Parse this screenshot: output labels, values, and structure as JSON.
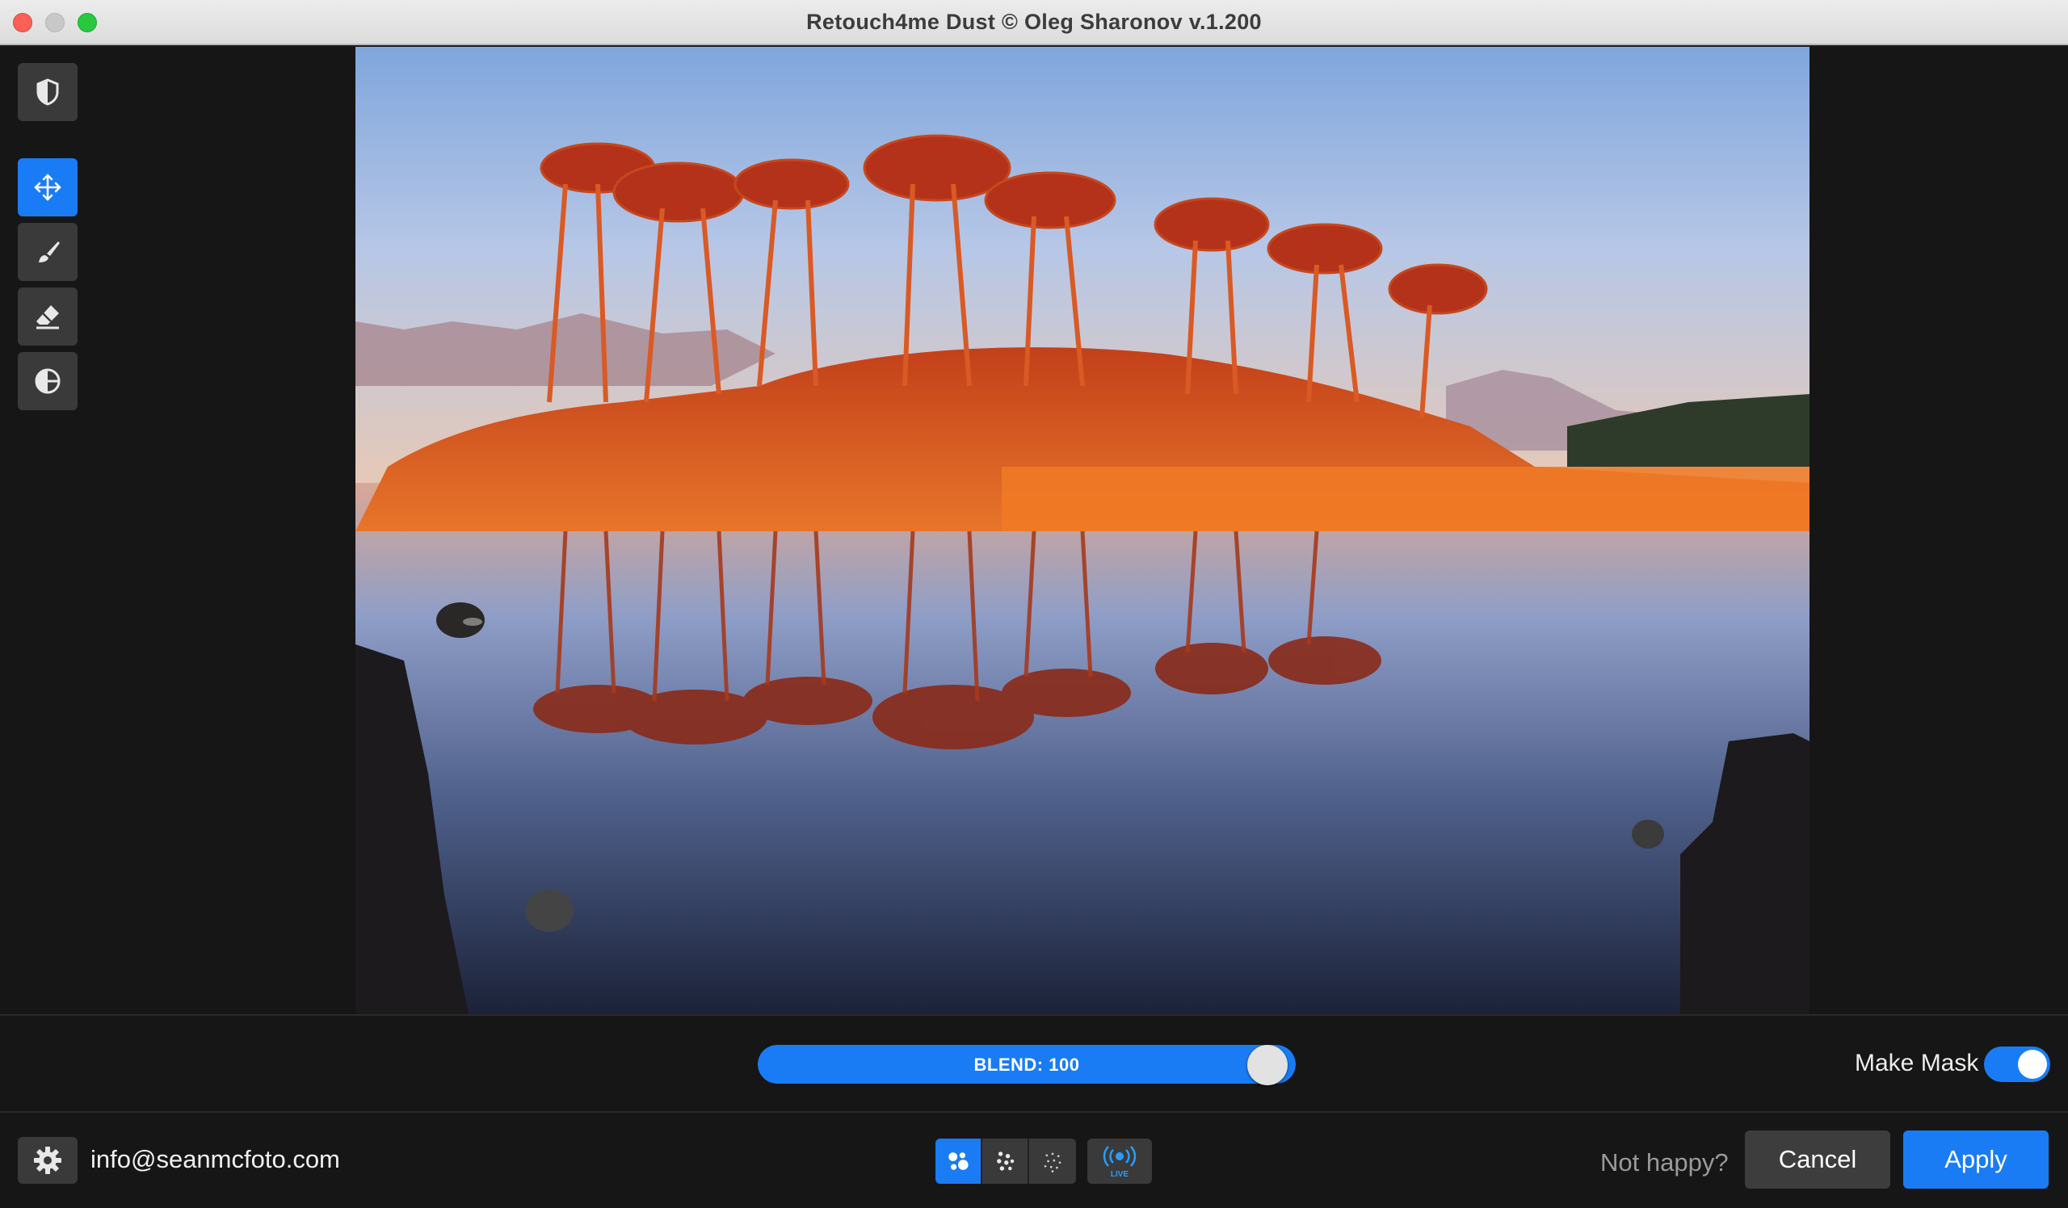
{
  "window": {
    "title": "Retouch4me Dust © Oleg Sharonov v.1.200"
  },
  "toolbar": {
    "tools": [
      {
        "name": "shield",
        "icon": "shield-icon",
        "active": false
      },
      {
        "name": "move",
        "icon": "move-arrows-icon",
        "active": true
      },
      {
        "name": "brush",
        "icon": "brush-icon",
        "active": false
      },
      {
        "name": "eraser",
        "icon": "eraser-icon",
        "active": false
      },
      {
        "name": "compare",
        "icon": "half-circle-icon",
        "active": false
      }
    ]
  },
  "image": {
    "description_icon": "landscape-photo"
  },
  "blend": {
    "label": "BLEND: 100",
    "value": 100,
    "max": 100
  },
  "mask": {
    "label": "Make Mask",
    "enabled": true
  },
  "footer": {
    "settings_icon": "gear-icon",
    "email": "info@seanmcfoto.com",
    "modes": [
      {
        "icon": "large-dots-icon",
        "active": true
      },
      {
        "icon": "medium-dots-icon",
        "active": false
      },
      {
        "icon": "small-dots-icon",
        "active": false
      }
    ],
    "live_label": "LIVE",
    "not_happy": "Not happy?",
    "cancel_label": "Cancel",
    "apply_label": "Apply"
  },
  "colors": {
    "accent": "#1a7cf5",
    "background": "#161616",
    "button": "#3a3a3a"
  }
}
